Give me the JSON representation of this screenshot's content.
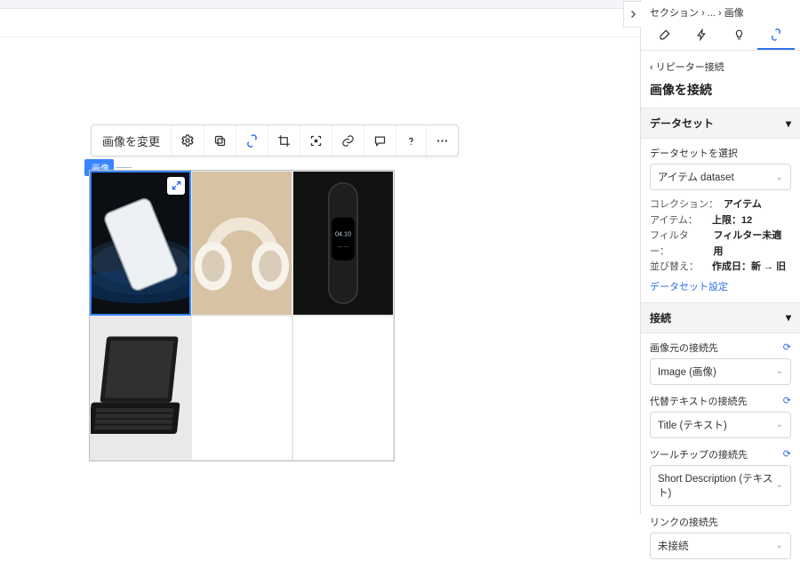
{
  "toolbar": {
    "change_image_label": "画像を変更"
  },
  "tag_label": "画像",
  "breadcrumb": {
    "root": "セクション",
    "mid": "...",
    "leaf": "画像"
  },
  "back_label": "リピーター接続",
  "panel_title": "画像を接続",
  "dataset_section": {
    "header": "データセット",
    "choose_label": "データセットを選択",
    "selected": "アイテム dataset",
    "collection": {
      "k": "コレクション：",
      "v": "アイテム"
    },
    "items": {
      "k": "アイテム：",
      "v": "上限：12"
    },
    "filter": {
      "k": "フィルター：",
      "v": "フィルター未適用"
    },
    "sort": {
      "k": "並び替え：",
      "v": "作成日：新 → 旧"
    },
    "settings_link": "データセット設定"
  },
  "connect_section": {
    "header": "接続",
    "image_src_label": "画像元の接続先",
    "image_src_value": "Image (画像)",
    "alt_label": "代替テキストの接続先",
    "alt_value": "Title (テキスト)",
    "tooltip_label": "ツールチップの接続先",
    "tooltip_value": "Short Description (テキスト)",
    "link_label": "リンクの接続先",
    "link_value": "未接続"
  }
}
